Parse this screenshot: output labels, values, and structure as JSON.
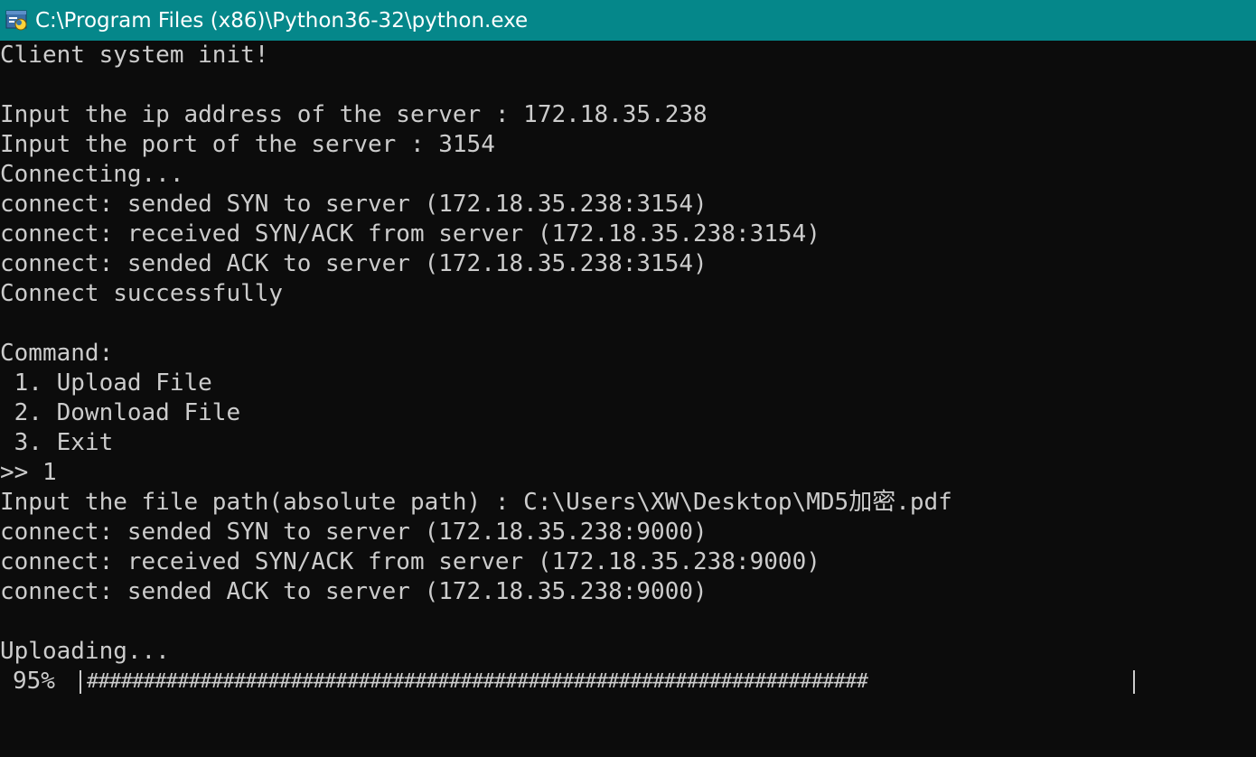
{
  "window": {
    "title": "C:\\Program Files (x86)\\Python36-32\\python.exe",
    "titlebar_color": "#05878a",
    "icon": "python-icon"
  },
  "console": {
    "lines": [
      "Client system init!",
      "",
      "Input the ip address of the server : 172.18.35.238",
      "Input the port of the server : 3154",
      "Connecting...",
      "connect: sended SYN to server (172.18.35.238:3154)",
      "connect: received SYN/ACK from server (172.18.35.238:3154)",
      "connect: sended ACK to server (172.18.35.238:3154)",
      "Connect successfully",
      "",
      "Command:",
      " 1. Upload File",
      " 2. Download File",
      " 3. Exit",
      ">> 1",
      "Input the file path(absolute path) : C:\\Users\\XW\\Desktop\\MD5加密.pdf",
      "connect: sended SYN to server (172.18.35.238:9000)",
      "connect: received SYN/ACK from server (172.18.35.238:9000)",
      "connect: sended ACK to server (172.18.35.238:9000)",
      "",
      "Uploading..."
    ],
    "text_color": "#cccccc",
    "background": "#0c0c0c"
  },
  "progress": {
    "percent_label": "95%",
    "fill_text": "#####################################################################",
    "value": 0.95
  }
}
